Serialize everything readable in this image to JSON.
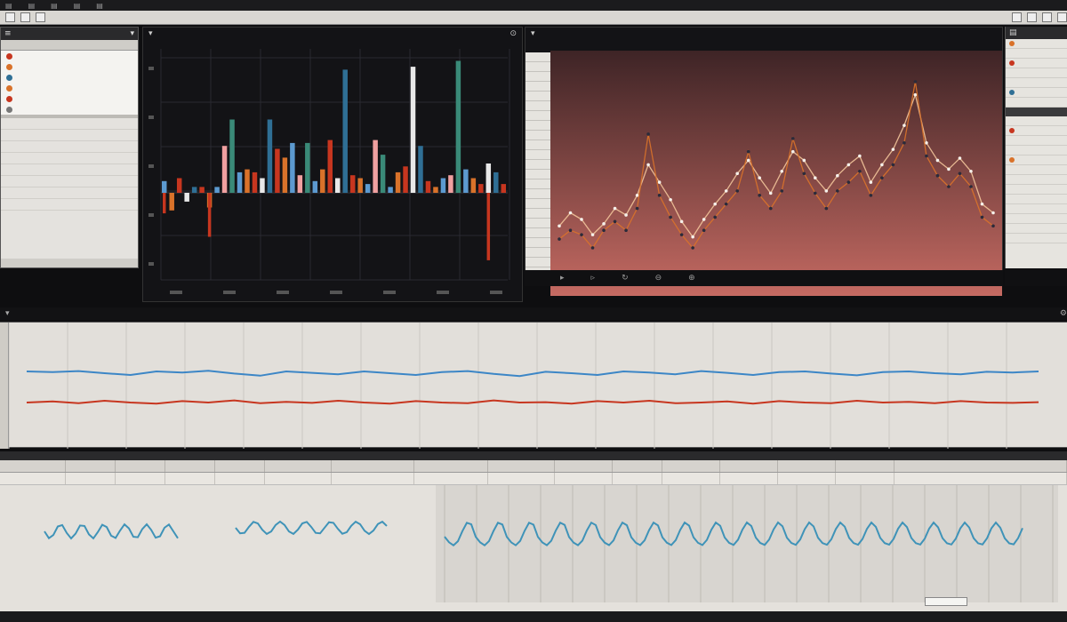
{
  "colors": {
    "accent_blue": "#5c9ad0",
    "accent_orange": "#d9722a",
    "accent_red": "#c7361f",
    "panel_dark": "#131316",
    "panel_light": "#e4e2de",
    "wave_teal": "#3f93b8"
  },
  "icons": [
    "close-icon",
    "minimize-icon",
    "settings-icon",
    "folder-icon",
    "search-icon",
    "zoom-icon"
  ],
  "chart_data": [
    {
      "type": "bar",
      "categories": [],
      "series": [
        {
          "values": [
            0.4,
            -0.6,
            0.5,
            -0.3,
            0.2,
            0.2,
            -0.5,
            0.2,
            1.6,
            2.5,
            0.7,
            0.8,
            0.7,
            0.5,
            2.5,
            1.5,
            1.2,
            1.7,
            0.6,
            1.7,
            0.4,
            0.8,
            1.8,
            0.5,
            4.2,
            0.6,
            0.5,
            0.3,
            1.8,
            1.3,
            0.2,
            0.7,
            0.9,
            4.3,
            1.6,
            0.4,
            0.2,
            0.5,
            0.6,
            4.5,
            0.8,
            0.5,
            0.3,
            1.0,
            0.7,
            0.3
          ]
        },
        {
          "values": [
            -0.7,
            0,
            0,
            0,
            0,
            0,
            -1.5,
            0,
            0,
            0,
            0,
            0,
            0,
            0,
            0,
            0,
            0,
            0,
            0,
            0,
            0,
            0,
            0,
            0,
            0,
            0,
            0,
            0,
            0,
            0,
            0,
            0,
            0,
            0,
            0,
            0,
            0,
            0,
            0,
            0,
            0,
            0,
            0,
            -2.3,
            0,
            0
          ]
        }
      ]
    },
    {
      "type": "line",
      "series": [
        {
          "values": [
            0.32,
            0.38,
            0.35,
            0.28,
            0.33,
            0.4,
            0.37,
            0.46,
            0.6,
            0.52,
            0.44,
            0.34,
            0.27,
            0.35,
            0.42,
            0.48,
            0.56,
            0.62,
            0.54,
            0.47,
            0.57,
            0.66,
            0.62,
            0.54,
            0.48,
            0.55,
            0.6,
            0.64,
            0.52,
            0.6,
            0.67,
            0.78,
            0.92,
            0.7,
            0.62,
            0.58,
            0.63,
            0.57,
            0.42,
            0.38
          ]
        },
        {
          "values": [
            0.26,
            0.3,
            0.28,
            0.22,
            0.3,
            0.34,
            0.3,
            0.4,
            0.74,
            0.46,
            0.36,
            0.28,
            0.22,
            0.3,
            0.36,
            0.42,
            0.48,
            0.66,
            0.46,
            0.4,
            0.48,
            0.72,
            0.56,
            0.47,
            0.4,
            0.48,
            0.52,
            0.57,
            0.46,
            0.54,
            0.6,
            0.7,
            0.98,
            0.64,
            0.55,
            0.5,
            0.56,
            0.5,
            0.36,
            0.32
          ]
        }
      ]
    },
    {
      "type": "line",
      "series": [
        {
          "values": [
            0.5,
            0.52,
            0.49,
            0.55,
            0.6,
            0.5,
            0.53,
            0.48,
            0.56,
            0.62,
            0.5,
            0.54,
            0.58,
            0.5,
            0.55,
            0.6,
            0.52,
            0.49,
            0.57,
            0.63,
            0.51,
            0.55,
            0.6,
            0.5,
            0.53,
            0.58,
            0.49,
            0.54,
            0.6,
            0.52,
            0.5,
            0.56,
            0.61,
            0.52,
            0.5,
            0.55,
            0.58,
            0.51,
            0.53,
            0.5
          ]
        },
        {
          "values": [
            0.5,
            0.47,
            0.52,
            0.45,
            0.5,
            0.53,
            0.46,
            0.5,
            0.44,
            0.52,
            0.48,
            0.51,
            0.45,
            0.5,
            0.53,
            0.46,
            0.5,
            0.52,
            0.44,
            0.5,
            0.49,
            0.53,
            0.46,
            0.5,
            0.45,
            0.52,
            0.5,
            0.47,
            0.53,
            0.46,
            0.5,
            0.52,
            0.45,
            0.5,
            0.48,
            0.52,
            0.46,
            0.5,
            0.51,
            0.49
          ]
        }
      ]
    }
  ]
}
